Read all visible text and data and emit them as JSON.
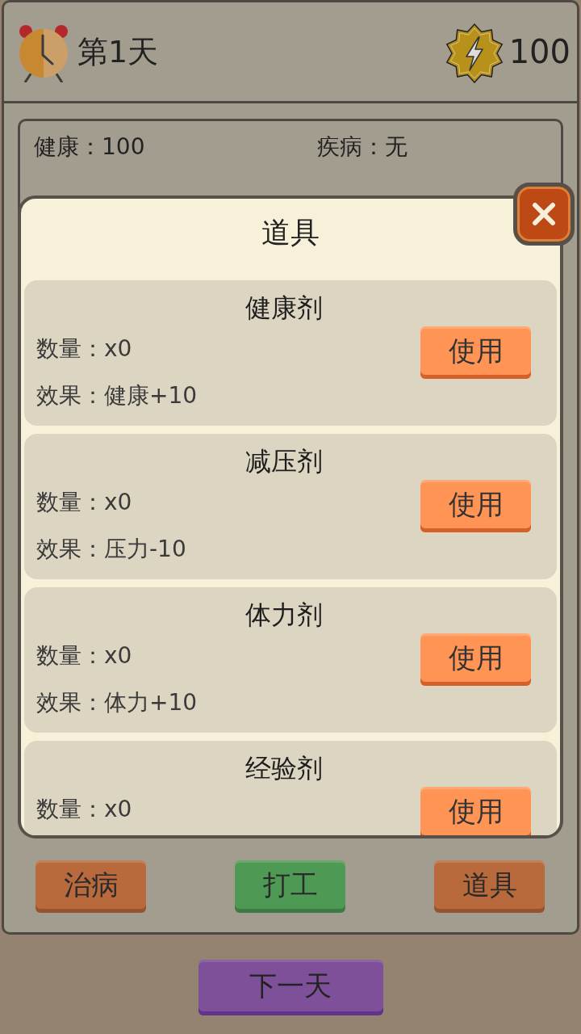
{
  "header": {
    "day": "第1天",
    "energy": "100"
  },
  "stats": [
    "健康：100",
    "疾病：无"
  ],
  "dialog": {
    "title": "道具",
    "items": [
      {
        "name": "健康剂",
        "quantity": "数量：x0",
        "effect": "效果：健康+10",
        "button": "使用"
      },
      {
        "name": "减压剂",
        "quantity": "数量：x0",
        "effect": "效果：压力-10",
        "button": "使用"
      },
      {
        "name": "体力剂",
        "quantity": "数量：x0",
        "effect": "效果：体力+10",
        "button": "使用"
      },
      {
        "name": "经验剂",
        "quantity": "数量：x0",
        "button": "使用"
      }
    ]
  },
  "actions": [
    {
      "label": "治病",
      "color": "#b96a3c"
    },
    {
      "label": "打工",
      "color": "#4e9a55"
    },
    {
      "label": "道具",
      "color": "#b96a3c"
    }
  ],
  "next_day": "下一天"
}
